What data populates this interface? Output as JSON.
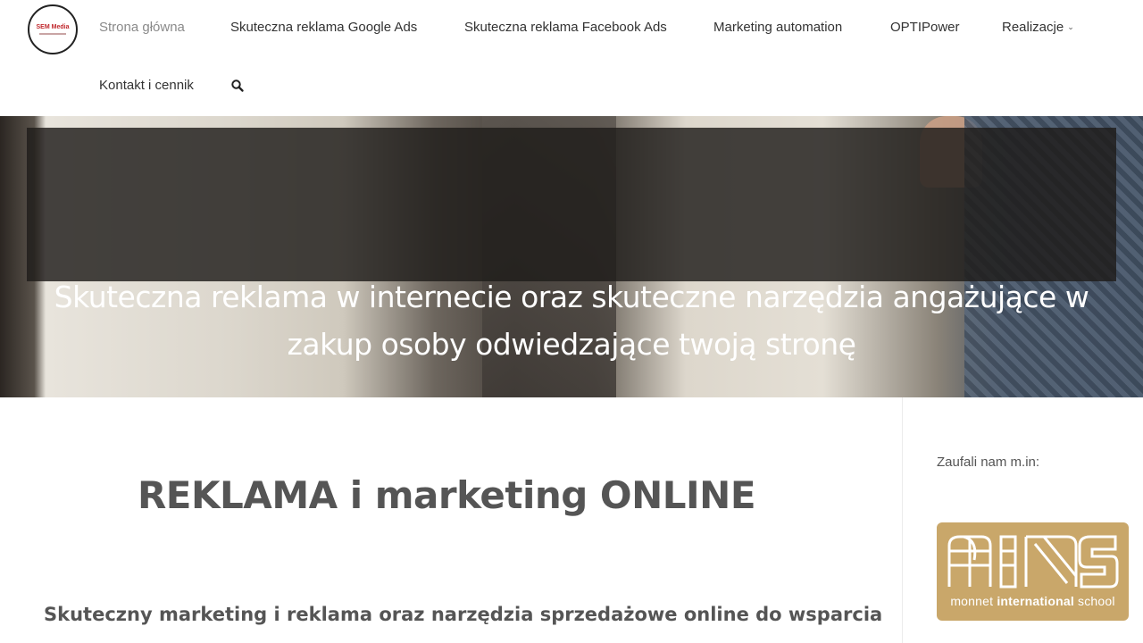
{
  "logo": {
    "text": "SEM Media"
  },
  "nav": {
    "items": [
      {
        "label": "Strona główna"
      },
      {
        "label": "Skuteczna reklama Google Ads"
      },
      {
        "label": "Skuteczna reklama Facebook Ads"
      },
      {
        "label": "Marketing automation"
      },
      {
        "label": "OPTIPower"
      },
      {
        "label": "Realizacje"
      },
      {
        "label": "Kontakt i cennik"
      }
    ],
    "active_index": 0
  },
  "hero": {
    "title": "Skuteczna reklama w internecie oraz skuteczne narzędzia angażujące w zakup osoby odwiedzające twoją stronę"
  },
  "main": {
    "title": "REKLAMA i marketing ONLINE",
    "subtitle": "Skuteczny marketing i reklama oraz narzędzia sprzedażowe online do wsparcia"
  },
  "sidebar": {
    "label": "Zaufali nam m.in:",
    "partner": {
      "caption_prefix": "monnet ",
      "caption_bold": "international",
      "caption_suffix": " school"
    }
  },
  "colors": {
    "accent": "#c0282d",
    "heading": "#555555",
    "partner_bg": "#c9a76a"
  }
}
